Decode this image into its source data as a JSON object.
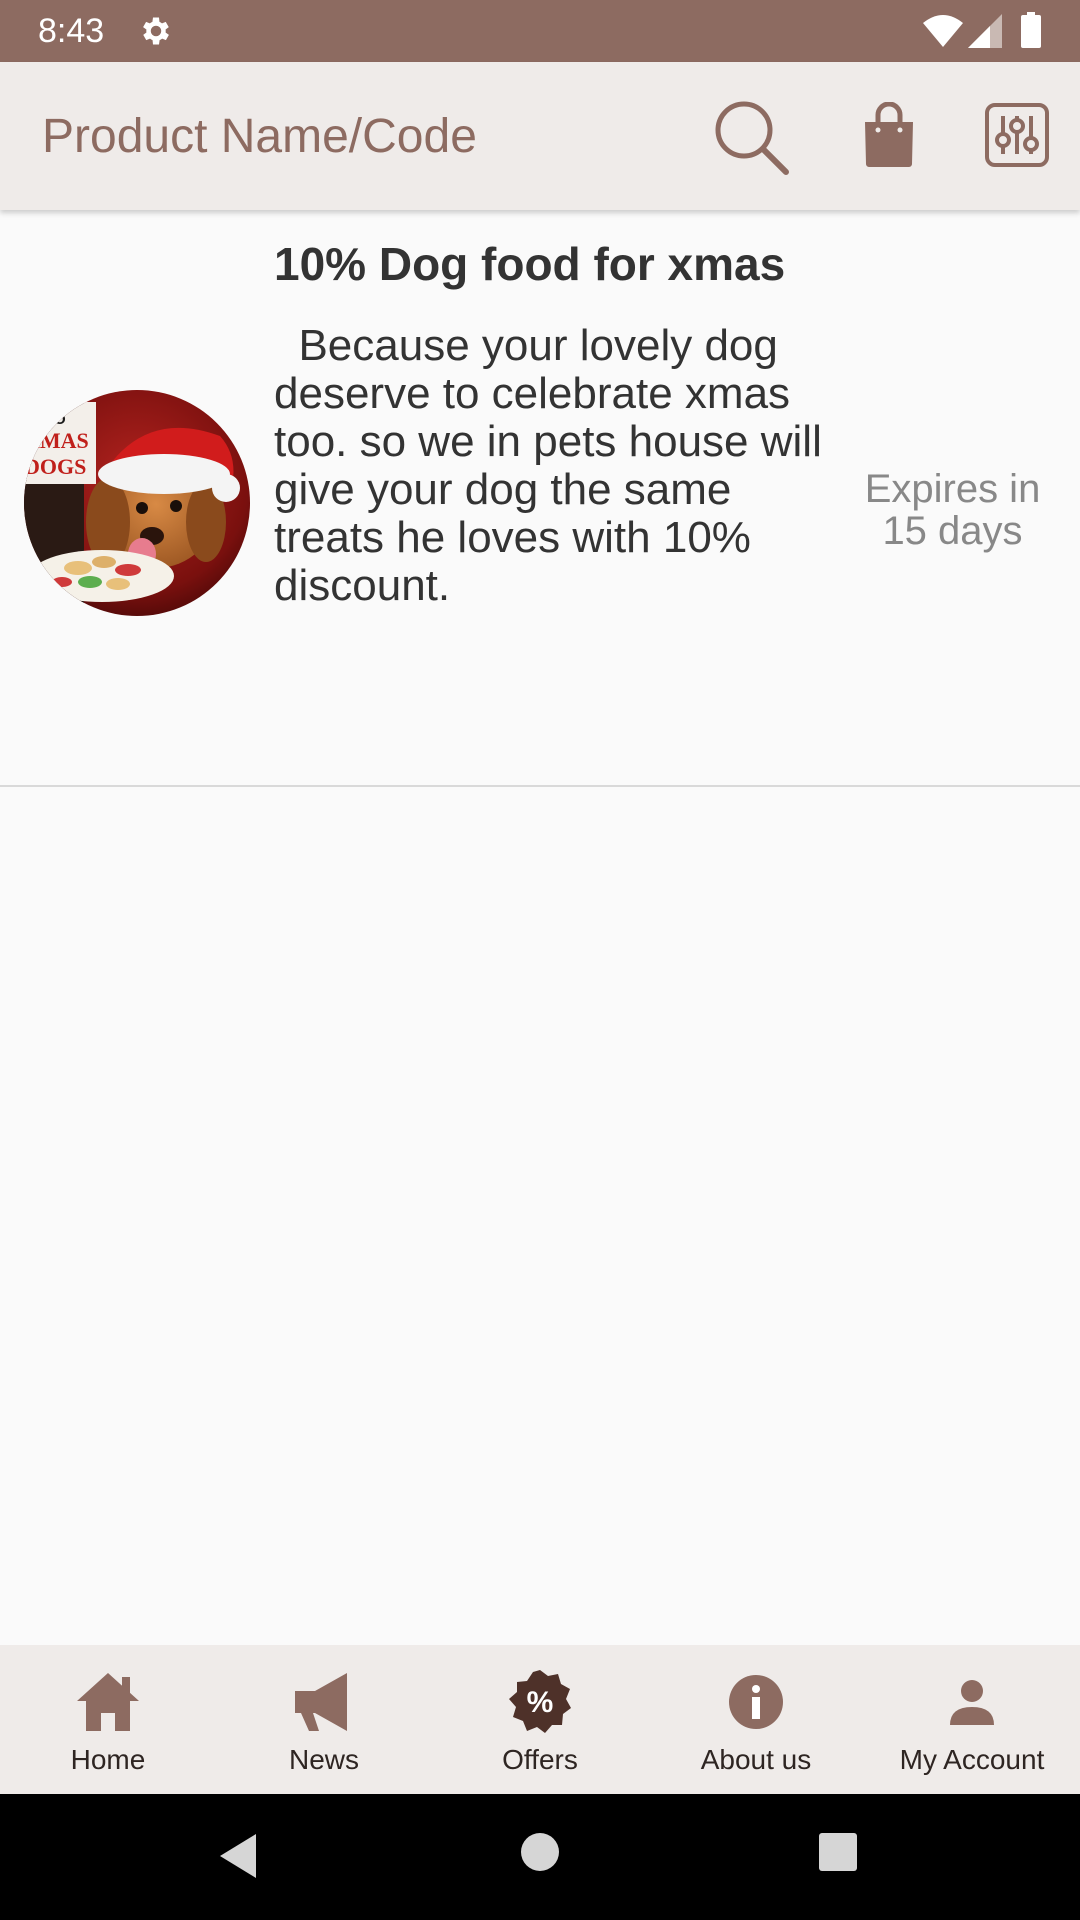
{
  "status_bar": {
    "time": "8:43",
    "icons": [
      "gear-icon",
      "wifi-icon",
      "signal-icon",
      "battery-icon"
    ]
  },
  "toolbar": {
    "search_placeholder": "Product Name/Code",
    "icons": [
      "search-icon",
      "shopping-bag-icon",
      "filter-sliders-icon"
    ]
  },
  "offer": {
    "title": "10% Dog food for xmas",
    "description": "  Because your lovely dog deserve to celebrate xmas too. so we in pets house will give your dog the same treats he loves with 10% discount.",
    "expiry": "Expires in 15 days",
    "image_icon": "dog-xmas-photo",
    "image_sign_lines": [
      "ALSO",
      "XMAS",
      "DOGS"
    ]
  },
  "bottom_nav": {
    "items": [
      {
        "label": "Home",
        "icon": "home-icon"
      },
      {
        "label": "News",
        "icon": "megaphone-icon"
      },
      {
        "label": "Offers",
        "icon": "percent-badge-icon"
      },
      {
        "label": "About us",
        "icon": "info-icon"
      },
      {
        "label": "My Account",
        "icon": "person-icon"
      }
    ],
    "active": "Offers"
  },
  "system_nav": {
    "icons": [
      "back-icon",
      "home-circle-icon",
      "recents-icon"
    ]
  },
  "colors": {
    "primary_brown": "#8D6B61",
    "toolbar_bg": "#EFEBE9",
    "active_icon": "#4E3129",
    "text_dark": "#333333",
    "text_muted": "#888888"
  }
}
